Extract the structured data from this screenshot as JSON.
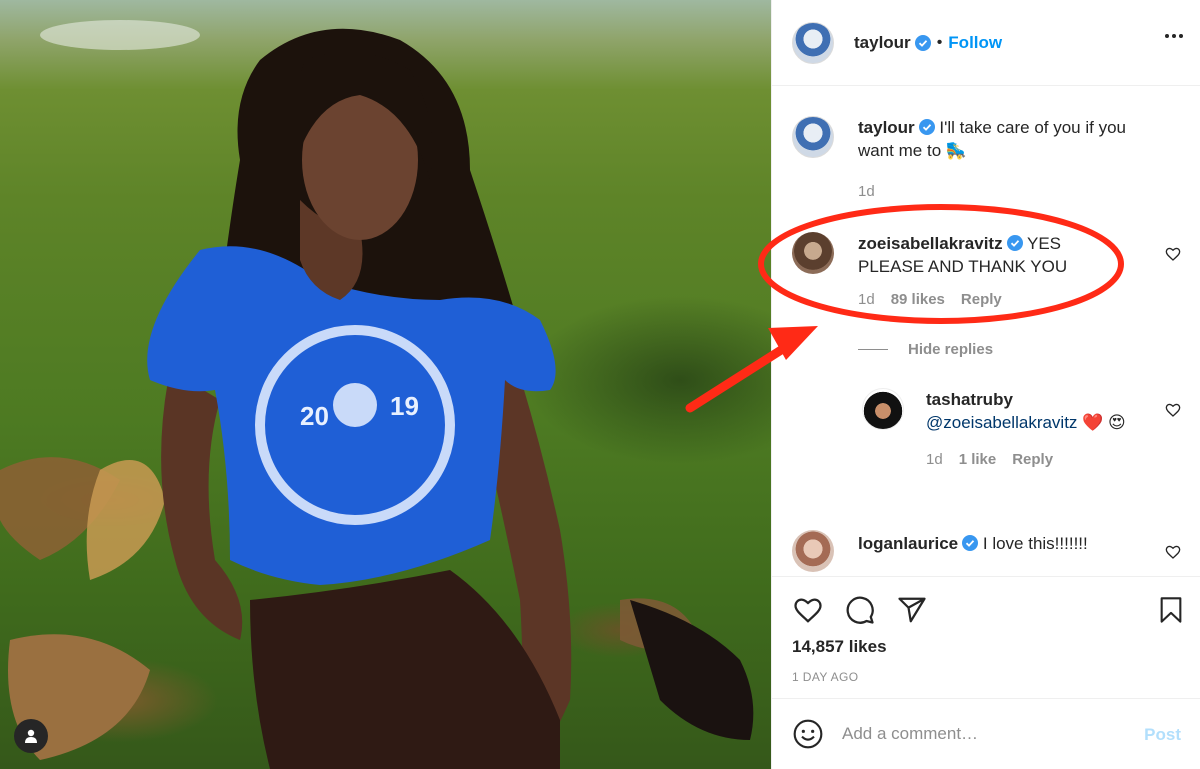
{
  "post": {
    "username": "taylour",
    "follow_label": "Follow",
    "separator": "•"
  },
  "caption": {
    "username": "taylour",
    "text": "I'll take care of you if you want me to 🛼",
    "time": "1d"
  },
  "comments": [
    {
      "username": "zoeisabellakravitz",
      "text": "YES PLEASE AND THANK YOU",
      "time": "1d",
      "likes": "89 likes",
      "reply": "Reply"
    },
    {
      "username": "loganlaurice",
      "text": "I love this!!!!!!!"
    }
  ],
  "hide_replies": "Hide replies",
  "reply": {
    "username": "tashatruby",
    "mention": "@zoeisabellakravitz",
    "text": "❤️ 😍",
    "time": "1d",
    "likes": "1 like",
    "reply": "Reply"
  },
  "footer": {
    "likes": "14,857 likes",
    "time": "1 DAY AGO"
  },
  "composer": {
    "placeholder": "Add a comment…",
    "post_label": "Post"
  },
  "colors": {
    "accent": "#0095f6",
    "annotation": "#ff2a16",
    "shirt": "#1f5fd6"
  },
  "icons": [
    "more-options-icon",
    "verified-badge-icon",
    "heart-icon",
    "comment-icon",
    "share-icon",
    "bookmark-icon",
    "emoji-icon",
    "user-tag-icon"
  ]
}
